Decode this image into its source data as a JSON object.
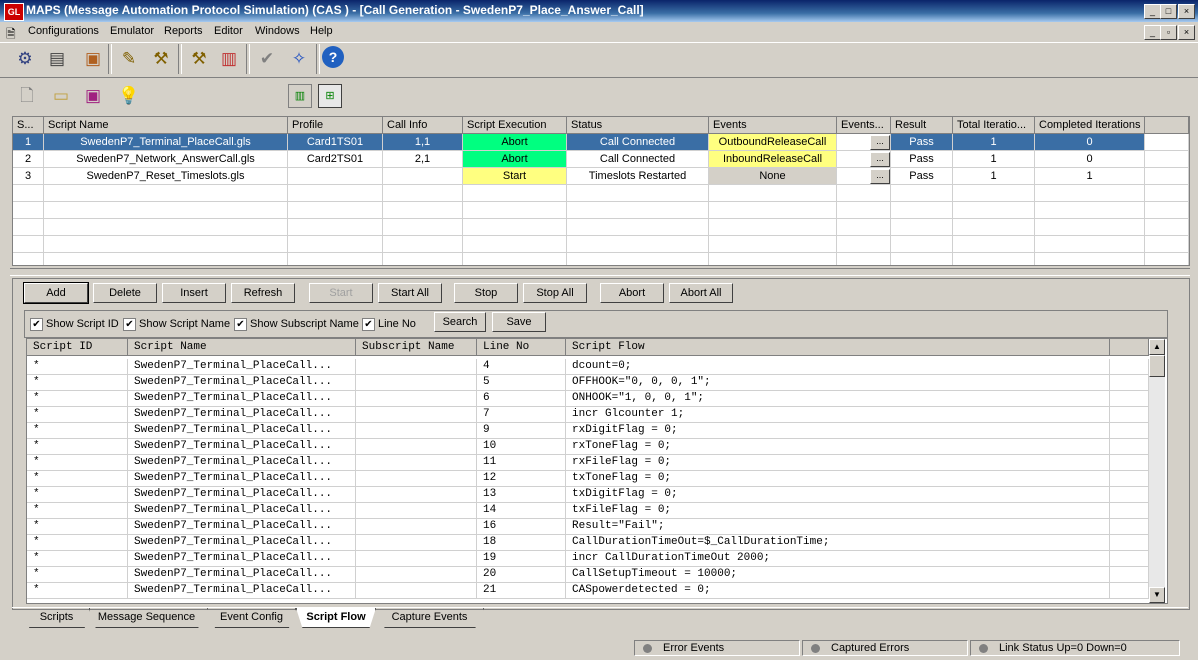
{
  "window": {
    "logo_text": "GL",
    "title": "MAPS (Message Automation Protocol Simulation)  (CAS  ) - [Call Generation - SwedenP7_Place_Answer_Call]",
    "controls": [
      "_",
      "□",
      "×"
    ],
    "child_controls": [
      "_",
      "▫",
      "×"
    ]
  },
  "menu": [
    "Configurations",
    "Emulator",
    "Reports",
    "Editor",
    "Windows",
    "Help"
  ],
  "scripts_table": {
    "headers": [
      "S...",
      "Script Name",
      "Profile",
      "Call Info",
      "Script Execution",
      "Status",
      "Events",
      "Events...",
      "Result",
      "Total Iteratio...",
      "Completed Iterations"
    ],
    "rows": [
      {
        "sno": "1",
        "name": "SwedenP7_Terminal_PlaceCall.gls",
        "profile": "Card1TS01",
        "callinfo": "1,1",
        "exec": "Abort",
        "status": "Call Connected",
        "events": "OutboundReleaseCall",
        "events_btn": "...",
        "result": "Pass",
        "total": "1",
        "completed": "0"
      },
      {
        "sno": "2",
        "name": "SwedenP7_Network_AnswerCall.gls",
        "profile": "Card2TS01",
        "callinfo": "2,1",
        "exec": "Abort",
        "status": "Call Connected",
        "events": "InboundReleaseCall",
        "events_btn": "...",
        "result": "Pass",
        "total": "1",
        "completed": "0"
      },
      {
        "sno": "3",
        "name": "SwedenP7_Reset_Timeslots.gls",
        "profile": "",
        "callinfo": "",
        "exec": "Start",
        "status": "Timeslots Restarted",
        "events": "None",
        "events_btn": "...",
        "result": "Pass",
        "total": "1",
        "completed": "1"
      }
    ]
  },
  "action_buttons": [
    "Add",
    "Delete",
    "Insert",
    "Refresh",
    "Start",
    "Start All",
    "Stop",
    "Stop All",
    "Abort",
    "Abort All"
  ],
  "filters": {
    "show_script_id": "Show Script ID",
    "show_script_name": "Show Script Name",
    "show_subscript_name": "Show Subscript Name",
    "line_no": "Line No",
    "search": "Search",
    "save": "Save"
  },
  "flow_table": {
    "headers": [
      "Script ID",
      "Script Name",
      "Subscript Name",
      "Line No",
      "Script Flow"
    ],
    "rows": [
      {
        "id": "*",
        "name": "SwedenP7_Terminal_PlaceCall...",
        "sub": "",
        "line": "4",
        "flow": "dcount=0;"
      },
      {
        "id": "*",
        "name": "SwedenP7_Terminal_PlaceCall...",
        "sub": "",
        "line": "5",
        "flow": "OFFHOOK=\"0, 0, 0, 1\";"
      },
      {
        "id": "*",
        "name": "SwedenP7_Terminal_PlaceCall...",
        "sub": "",
        "line": "6",
        "flow": "ONHOOK=\"1, 0, 0, 1\";"
      },
      {
        "id": "*",
        "name": "SwedenP7_Terminal_PlaceCall...",
        "sub": "",
        "line": "7",
        "flow": "incr Glcounter 1;"
      },
      {
        "id": "*",
        "name": "SwedenP7_Terminal_PlaceCall...",
        "sub": "",
        "line": "9",
        "flow": "rxDigitFlag = 0;"
      },
      {
        "id": "*",
        "name": "SwedenP7_Terminal_PlaceCall...",
        "sub": "",
        "line": "10",
        "flow": "rxToneFlag = 0;"
      },
      {
        "id": "*",
        "name": "SwedenP7_Terminal_PlaceCall...",
        "sub": "",
        "line": "11",
        "flow": "rxFileFlag = 0;"
      },
      {
        "id": "*",
        "name": "SwedenP7_Terminal_PlaceCall...",
        "sub": "",
        "line": "12",
        "flow": "txToneFlag = 0;"
      },
      {
        "id": "*",
        "name": "SwedenP7_Terminal_PlaceCall...",
        "sub": "",
        "line": "13",
        "flow": "txDigitFlag = 0;"
      },
      {
        "id": "*",
        "name": "SwedenP7_Terminal_PlaceCall...",
        "sub": "",
        "line": "14",
        "flow": "txFileFlag = 0;"
      },
      {
        "id": "*",
        "name": "SwedenP7_Terminal_PlaceCall...",
        "sub": "",
        "line": "16",
        "flow": "Result=\"Fail\";"
      },
      {
        "id": "*",
        "name": "SwedenP7_Terminal_PlaceCall...",
        "sub": "",
        "line": "18",
        "flow": "CallDurationTimeOut=$_CallDurationTime;"
      },
      {
        "id": "*",
        "name": "SwedenP7_Terminal_PlaceCall...",
        "sub": "",
        "line": "19",
        "flow": "incr CallDurationTimeOut 2000;"
      },
      {
        "id": "*",
        "name": "SwedenP7_Terminal_PlaceCall...",
        "sub": "",
        "line": "20",
        "flow": "CallSetupTimeout = 10000;"
      },
      {
        "id": "*",
        "name": "SwedenP7_Terminal_PlaceCall...",
        "sub": "",
        "line": "21",
        "flow": "CASpowerdetected = 0;"
      }
    ]
  },
  "tabs": [
    "Scripts",
    "Message Sequence",
    "Event Config",
    "Script Flow",
    "Capture Events"
  ],
  "active_tab": "Script Flow",
  "status_bar": [
    "Error Events",
    "Captured Errors",
    "Link Status Up=0 Down=0"
  ],
  "colors": {
    "selected_row": "#3a6ea5",
    "abort_green": "#00ff80",
    "event_yellow": "#ffff80"
  }
}
